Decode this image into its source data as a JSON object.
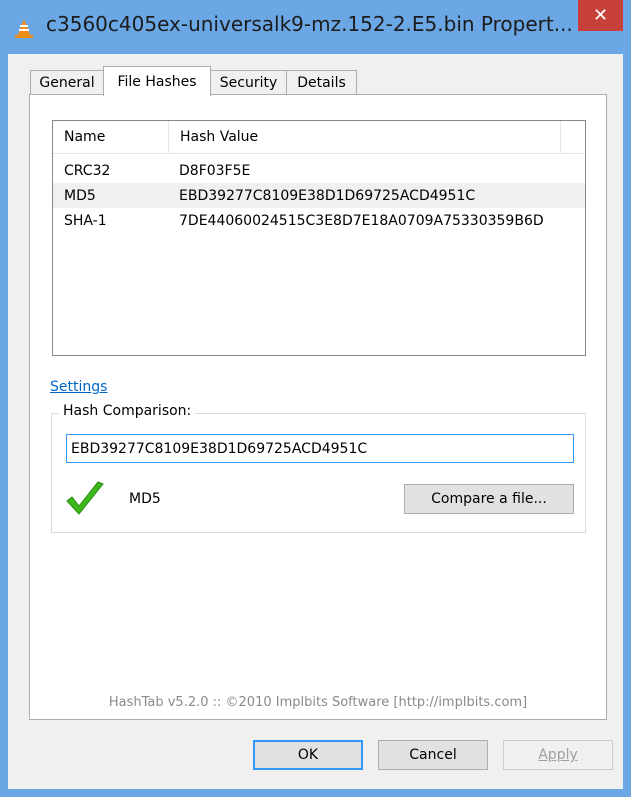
{
  "window": {
    "title": "c3560c405ex-universalk9-mz.152-2.E5.bin Propert...",
    "close_glyph": "✕"
  },
  "tabs": [
    {
      "label": "General"
    },
    {
      "label": "File Hashes"
    },
    {
      "label": "Security"
    },
    {
      "label": "Details"
    }
  ],
  "list": {
    "columns": [
      "Name",
      "Hash Value"
    ],
    "rows": [
      {
        "name": "CRC32",
        "hash": "D8F03F5E"
      },
      {
        "name": "MD5",
        "hash": "EBD39277C8109E38D1D69725ACD4951C"
      },
      {
        "name": "SHA-1",
        "hash": "7DE44060024515C3E8D7E18A0709A75330359B6D"
      }
    ]
  },
  "settings_link": "Settings",
  "comparison": {
    "label": "Hash Comparison:",
    "value": "EBD39277C8109E38D1D69725ACD4951C",
    "match_label": "MD5",
    "compare_button": "Compare a file..."
  },
  "footer": "HashTab v5.2.0 :: ©2010 Implbits Software [http://implbits.com]",
  "buttons": {
    "ok": "OK",
    "cancel": "Cancel",
    "apply": "Apply"
  },
  "colors": {
    "titlebar": "#6ba7e5",
    "close": "#c7413a",
    "link": "#0066cc",
    "check": "#3cb81a"
  },
  "icons": {
    "title": "vlc-cone-icon",
    "match": "checkmark-icon"
  }
}
